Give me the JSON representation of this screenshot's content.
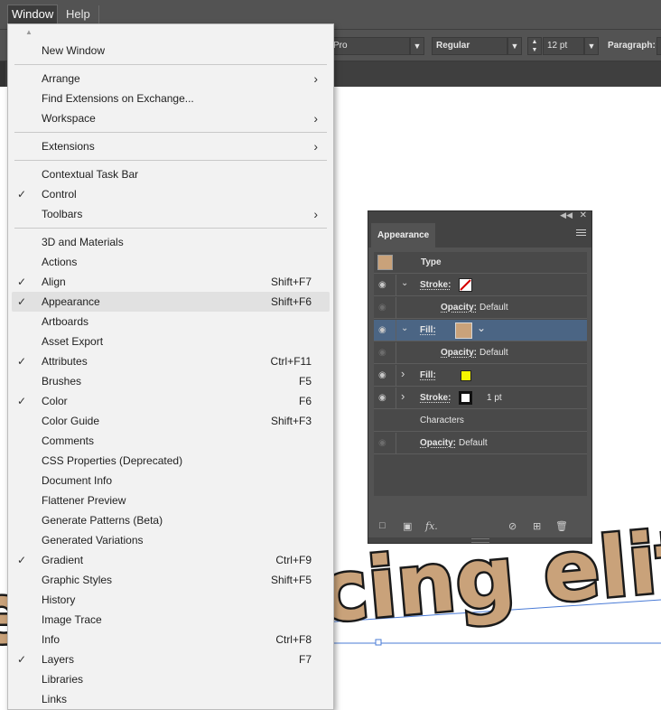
{
  "menubar": {
    "items": [
      {
        "label": "Window",
        "active": true
      },
      {
        "label": "Help",
        "active": false
      }
    ]
  },
  "controlbar": {
    "font_family_partial": "Pro",
    "font_style": "Regular",
    "font_size": "12 pt",
    "paragraph_label": "Paragraph:"
  },
  "canvas": {
    "text": "cing elit,",
    "fill_color": "#c9a27a",
    "stroke_color": "#1a1a1a",
    "path_color": "#4a7bd6"
  },
  "window_menu": {
    "scroll_indicator": "▲",
    "items": [
      {
        "label": "New Window"
      },
      {
        "separator": true
      },
      {
        "label": "Arrange",
        "submenu": true
      },
      {
        "label": "Find Extensions on Exchange..."
      },
      {
        "label": "Workspace",
        "submenu": true
      },
      {
        "separator": true
      },
      {
        "label": "Extensions",
        "submenu": true
      },
      {
        "separator": true
      },
      {
        "label": "Contextual Task Bar"
      },
      {
        "label": "Control",
        "checked": true
      },
      {
        "label": "Toolbars",
        "submenu": true
      },
      {
        "separator": true
      },
      {
        "label": "3D and Materials"
      },
      {
        "label": "Actions"
      },
      {
        "label": "Align",
        "checked": true,
        "shortcut": "Shift+F7"
      },
      {
        "label": "Appearance",
        "checked": true,
        "shortcut": "Shift+F6",
        "highlighted": true
      },
      {
        "label": "Artboards"
      },
      {
        "label": "Asset Export"
      },
      {
        "label": "Attributes",
        "checked": true,
        "shortcut": "Ctrl+F11"
      },
      {
        "label": "Brushes",
        "shortcut": "F5"
      },
      {
        "label": "Color",
        "checked": true,
        "shortcut": "F6"
      },
      {
        "label": "Color Guide",
        "shortcut": "Shift+F3"
      },
      {
        "label": "Comments"
      },
      {
        "label": "CSS Properties (Deprecated)"
      },
      {
        "label": "Document Info"
      },
      {
        "label": "Flattener Preview"
      },
      {
        "label": "Generate Patterns (Beta)"
      },
      {
        "label": "Generated Variations"
      },
      {
        "label": "Gradient",
        "checked": true,
        "shortcut": "Ctrl+F9"
      },
      {
        "label": "Graphic Styles",
        "shortcut": "Shift+F5"
      },
      {
        "label": "History"
      },
      {
        "label": "Image Trace"
      },
      {
        "label": "Info",
        "shortcut": "Ctrl+F8"
      },
      {
        "label": "Layers",
        "checked": true,
        "shortcut": "F7"
      },
      {
        "label": "Libraries"
      },
      {
        "label": "Links"
      }
    ]
  },
  "appearance_panel": {
    "tab_label": "Appearance",
    "rows": [
      {
        "kind": "header",
        "label": "Type",
        "swatch": "#c9a27a"
      },
      {
        "kind": "stroke",
        "label": "Stroke:",
        "swatch": "none",
        "expanded": true
      },
      {
        "kind": "opacity",
        "label": "Opacity:",
        "value": "Default"
      },
      {
        "kind": "fill",
        "label": "Fill:",
        "swatch": "#c9a27a",
        "expanded": true,
        "selected": true
      },
      {
        "kind": "opacity",
        "label": "Opacity:",
        "value": "Default"
      },
      {
        "kind": "fill",
        "label": "Fill:",
        "swatch": "#f5f500",
        "expanded": false
      },
      {
        "kind": "stroke",
        "label": "Stroke:",
        "swatch": "#111111",
        "value": "1 pt",
        "expanded": false
      },
      {
        "kind": "characters",
        "label": "Characters"
      },
      {
        "kind": "opacity",
        "label": "Opacity:",
        "value": "Default"
      }
    ],
    "bottom_icons": [
      "new-stroke-icon",
      "new-fill-icon",
      "fx-icon",
      "clear-appearance-icon",
      "duplicate-item-icon",
      "delete-item-icon"
    ],
    "fx_label": "fx."
  }
}
